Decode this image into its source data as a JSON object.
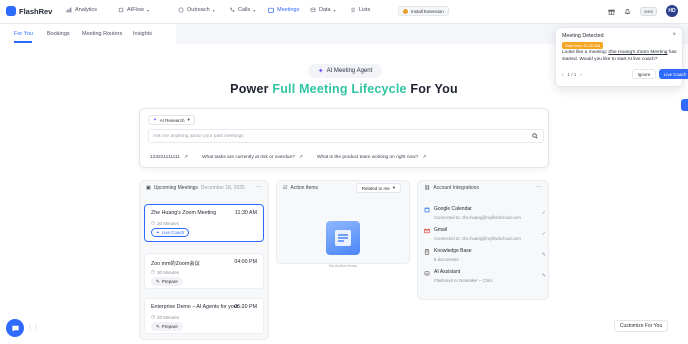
{
  "brand": {
    "name": "FlashRev",
    "accent": "#2f6bff"
  },
  "nav": {
    "items": [
      {
        "label": "Analytics",
        "icon": "analytics-icon"
      },
      {
        "label": "AIFlow",
        "icon": "aiflow-icon"
      },
      {
        "label": "Outreach",
        "icon": "outreach-icon"
      },
      {
        "label": "Calls",
        "icon": "phone-icon"
      },
      {
        "label": "Meetings",
        "icon": "meetings-icon"
      },
      {
        "label": "Data",
        "icon": "data-icon"
      },
      {
        "label": "Lists",
        "icon": "lists-icon"
      }
    ],
    "active": "Meetings",
    "install_extension": "Install Extension",
    "plan_badge": "WEB",
    "avatar_initials": "HD"
  },
  "subtabs": {
    "items": [
      "For You",
      "Bookings",
      "Meeting Routers",
      "Insights"
    ],
    "active": "For You"
  },
  "hero": {
    "pill": "AI Meeting Agent",
    "title_before": "Power",
    "title_accent": "Full Meeting Lifecycle",
    "title_after": "For You"
  },
  "search": {
    "mode": "AI Research",
    "placeholder": "Ask me anything about your past meetings",
    "suggestions": [
      "123221111111",
      "What tasks are currently at risk or overdue?",
      "What is the product team working on right now?"
    ]
  },
  "upcoming": {
    "title": "Upcoming Meetings",
    "date": "December 18, 2025",
    "meetings": [
      {
        "title": "Zhe Huang's Zoom Meeting",
        "time": "11:30 AM",
        "duration": "30 Minutes",
        "button": "Live Coach"
      },
      {
        "title": "Zoo mm的Zoom会议",
        "time": "04:00 PM",
        "duration": "30 Minutes",
        "button": "Prepare"
      },
      {
        "title": "Enterprise Demo – AI Agents for your ...",
        "time": "05:20 PM",
        "duration": "20 Minutes",
        "button": "Prepare"
      }
    ]
  },
  "action_items": {
    "title": "Action Items",
    "filter": "Related to me",
    "empty": "No Action Items"
  },
  "integrations": {
    "title": "Account Integrations",
    "items": [
      {
        "name": "Google Calendar",
        "sub": "Connected to: zhe.huang@myflashcloud.com",
        "icon": "google-calendar-icon"
      },
      {
        "name": "Gmail",
        "sub": "Connected to: zhe.huang@myflashcloud.com",
        "icon": "gmail-icon"
      },
      {
        "name": "Knowledge Base",
        "sub": "5 documents",
        "icon": "knowledge-base-icon"
      },
      {
        "name": "AI Assistant",
        "sub": "Flashrevd AI Notetaker – Chris",
        "icon": "ai-assistant-icon"
      }
    ]
  },
  "notification": {
    "title": "Meeting Detected",
    "badge": "Start from 11:30 AM",
    "msg_prefix": "Looks like a meeting:",
    "meeting_name": "Zhe Huang's Zoom Meeting",
    "msg_suffix": "has started. Would you like to start AI live coach?",
    "pager": "1 / 1",
    "ignore": "Ignore",
    "live": "Live Coach"
  },
  "customize": "Customize For You"
}
